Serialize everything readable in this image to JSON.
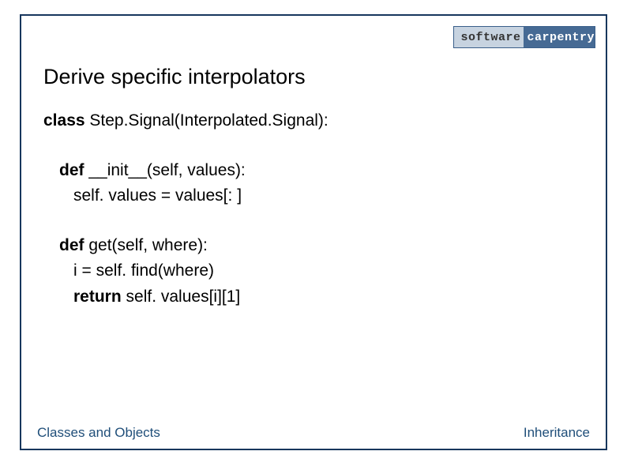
{
  "logo": {
    "left": "software",
    "right": "carpentry"
  },
  "title": "Derive specific interpolators",
  "code": {
    "class_kw": "class",
    "class_decl": " Step.Signal(Interpolated.Signal):",
    "def_kw": "def",
    "init_sig": " __init__(self, values):",
    "init_body": "self. values = values[: ]",
    "get_sig": " get(self, where):",
    "get_body1": "i = self. find(where)",
    "return_kw": "return",
    "return_rest": " self. values[i][1]"
  },
  "footer": {
    "left": "Classes and Objects",
    "right": "Inheritance"
  }
}
